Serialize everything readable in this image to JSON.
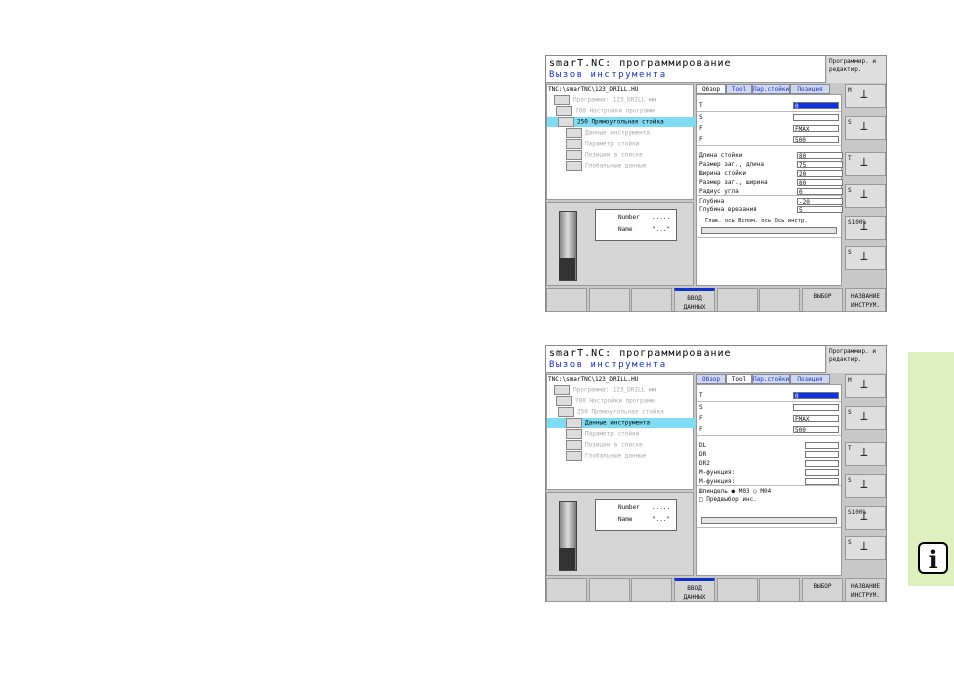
{
  "info_icon": {
    "glyph": "i",
    "color": "#dff0c0"
  },
  "screens": [
    {
      "title": "smarT.NC: программирование",
      "subtitle": "Вызов инструмента",
      "mode": "Программир. и редактир.",
      "path": "TNC:\\smarTNC\\123_DRILL.HU",
      "tree": [
        {
          "text": "Программа: 123_DRILL мм",
          "state": "dim"
        },
        {
          "text": "700 Настройки программ",
          "state": "dim"
        },
        {
          "text": "250 Прямоугольная стойка",
          "state": "sel"
        },
        {
          "text": "Данные инструмента",
          "state": "dim"
        },
        {
          "text": "Параметр стойки",
          "state": "dim"
        },
        {
          "text": "Позиции в списке",
          "state": "dim"
        },
        {
          "text": "Глобальные данные",
          "state": "dim"
        }
      ],
      "preview": {
        "number_label": "Number",
        "number_value": ".....",
        "name_label": "Name",
        "name_value": "\"...\""
      },
      "tabs": [
        "Обзор",
        "Tool",
        "Пар.стойки",
        "Позиция"
      ],
      "active_tab": 0,
      "fields": [
        {
          "label": "T",
          "value": "0"
        },
        {
          "label": "S",
          "value": ""
        },
        {
          "label": "F",
          "value": "FMAX"
        },
        {
          "label": "F",
          "value": "500"
        },
        {
          "label": "Длина стойки",
          "value": "80"
        },
        {
          "label": "Размер заг., длина",
          "value": "75"
        },
        {
          "label": "Ширина стойки",
          "value": "20"
        },
        {
          "label": "Размер заг., ширина",
          "value": "80"
        },
        {
          "label": "Радиус угла",
          "value": "0"
        },
        {
          "label": "Глубина",
          "value": "-20"
        },
        {
          "label": "Глубина врезания",
          "value": "5"
        }
      ],
      "axis_header": "Глав. ось   Вспом. ось   Ось инстр.",
      "softkeys": [
        "",
        "",
        "",
        "ВВОД ДАННЫХ",
        "",
        "",
        "ВЫБОР",
        "НАЗВАНИЕ ИНСТРУМ."
      ],
      "side_buttons": [
        "M",
        "S",
        "T",
        "S",
        "S100%",
        "S"
      ]
    },
    {
      "title": "smarT.NC: программирование",
      "subtitle": "Вызов инструмента",
      "mode": "Программир. и редактир.",
      "path": "TNC:\\smarTNC\\123_DRILL.HU",
      "tree": [
        {
          "text": "Программа: 123_DRILL мм",
          "state": "dim"
        },
        {
          "text": "700 Настройки программ",
          "state": "dim"
        },
        {
          "text": "250 Прямоугольная стойка",
          "state": "dim"
        },
        {
          "text": "Данные инструмента",
          "state": "sel"
        },
        {
          "text": "Параметр стойки",
          "state": "dim"
        },
        {
          "text": "Позиции в списке",
          "state": "dim"
        },
        {
          "text": "Глобальные данные",
          "state": "dim"
        }
      ],
      "preview": {
        "number_label": "Number",
        "number_value": ".....",
        "name_label": "Name",
        "name_value": "\"...\""
      },
      "tabs": [
        "Обзор",
        "Tool",
        "Пар.стойки",
        "Позиция"
      ],
      "active_tab": 1,
      "fields": [
        {
          "label": "T",
          "value": "0"
        },
        {
          "label": "S",
          "value": ""
        },
        {
          "label": "F",
          "value": "FMAX"
        },
        {
          "label": "F",
          "value": "500"
        },
        {
          "label": "DL",
          "value": ""
        },
        {
          "label": "DR",
          "value": ""
        },
        {
          "label": "DR2",
          "value": ""
        },
        {
          "label": "M-функция:",
          "value": ""
        },
        {
          "label": "M-функция:",
          "value": ""
        },
        {
          "label": "Шпиндель ● M03 ○ M04",
          "value": ""
        },
        {
          "label": "□ Предвыбор инс.",
          "value": ""
        }
      ],
      "axis_header": "",
      "softkeys": [
        "",
        "",
        "",
        "ВВОД ДАННЫХ",
        "",
        "",
        "ВЫБОР",
        "НАЗВАНИЕ ИНСТРУМ."
      ],
      "side_buttons": [
        "M",
        "S",
        "T",
        "S",
        "S100%",
        "S"
      ]
    }
  ]
}
